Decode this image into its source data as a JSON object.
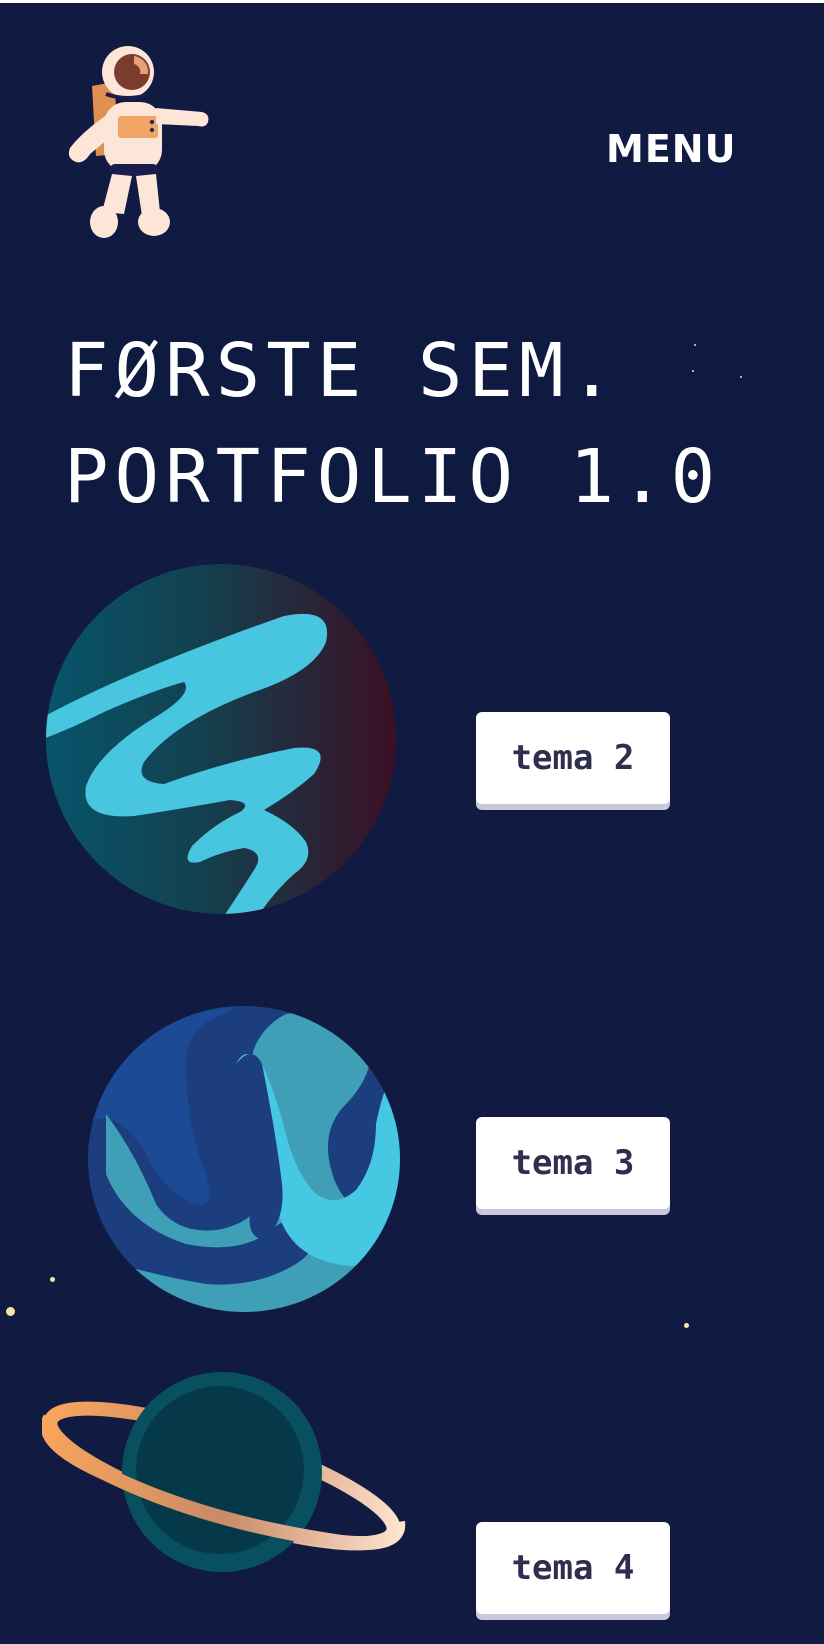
{
  "header": {
    "menu_label": "MENU",
    "logo_icon": "astronaut-icon"
  },
  "hero": {
    "title_line1": "FØRSTE SEM.",
    "title_line2": "PORTFOLIO 1.0"
  },
  "topics": [
    {
      "label": "tema 2",
      "icon": "blue-swirl-planet-icon"
    },
    {
      "label": "tema 3",
      "icon": "striped-blue-planet-icon"
    },
    {
      "label": "tema 4",
      "icon": "ringed-planet-icon"
    }
  ],
  "colors": {
    "background": "#111a40",
    "button_bg": "#ffffff",
    "button_text": "#2f2e4f",
    "accent_cyan": "#46c8e0",
    "accent_orange": "#f6a560"
  }
}
